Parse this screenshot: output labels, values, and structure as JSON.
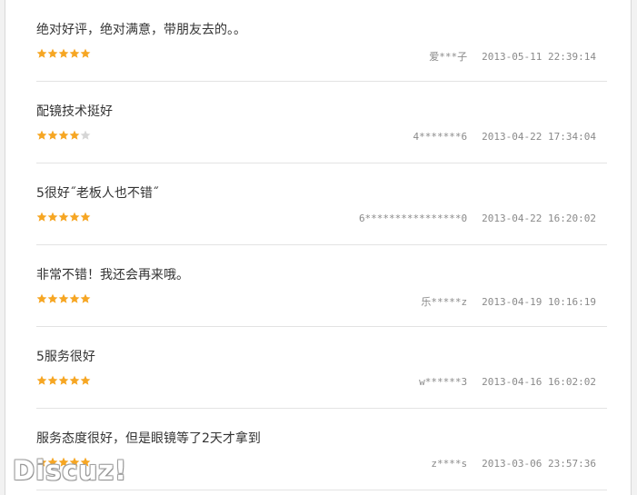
{
  "colors": {
    "star_on": "#f6a623",
    "star_off": "#d6d6d6"
  },
  "reviews": [
    {
      "text": "绝对好评，绝对满意，带朋友去的。。",
      "rating": 5,
      "user": "爱***子",
      "time": "2013-05-11 22:39:14"
    },
    {
      "text": "配镜技术挺好",
      "rating": 4,
      "user": "4*******6",
      "time": "2013-04-22 17:34:04"
    },
    {
      "text": "5很好˝老板人也不错˝",
      "rating": 5,
      "user": "6****************0",
      "time": "2013-04-22 16:20:02"
    },
    {
      "text": "非常不错！我还会再来哦。",
      "rating": 5,
      "user": "乐*****z",
      "time": "2013-04-19 10:16:19"
    },
    {
      "text": "5服务很好",
      "rating": 5,
      "user": "w******3",
      "time": "2013-04-16 16:02:02"
    },
    {
      "text": "服务态度很好，但是眼镜等了2天才拿到",
      "rating": 5,
      "user": "z****s",
      "time": "2013-03-06 23:57:36"
    }
  ],
  "watermark": "Discuz!"
}
